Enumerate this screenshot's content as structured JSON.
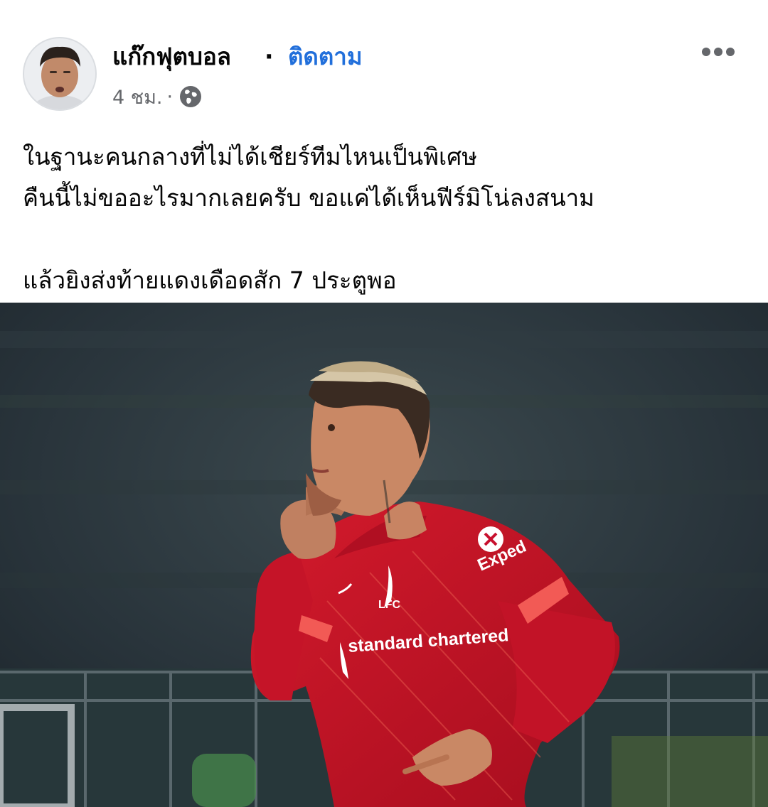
{
  "post": {
    "author_name": "แก๊กฟุตบอล",
    "separator": "·",
    "follow_label": "ติดตาม",
    "timestamp": "4 ชม.",
    "meta_separator": "·",
    "privacy_icon": "globe-icon",
    "more_icon": "more-horizontal-icon",
    "text_lines": [
      "ในฐานะคนกลางที่ไม่ได้เชียร์ทีมไหนเป็นพิเศษ",
      "คืนนี้ไม่ขออะไรมากเลยครับ ขอแค่ได้เห็นฟีร์มิโน่ลงสนาม",
      "แล้วยิงส่งท้ายแดงเดือดสัก 7 ประตูพอ"
    ],
    "photo": {
      "shirt_sponsor": "standard chartered",
      "sleeve_sponsor": "Exped",
      "crest_text": "LFC"
    }
  },
  "colors": {
    "accent": "#216fdb",
    "secondary_text": "#65676b",
    "primary_text": "#050505",
    "jersey_red": "#c8102e"
  }
}
